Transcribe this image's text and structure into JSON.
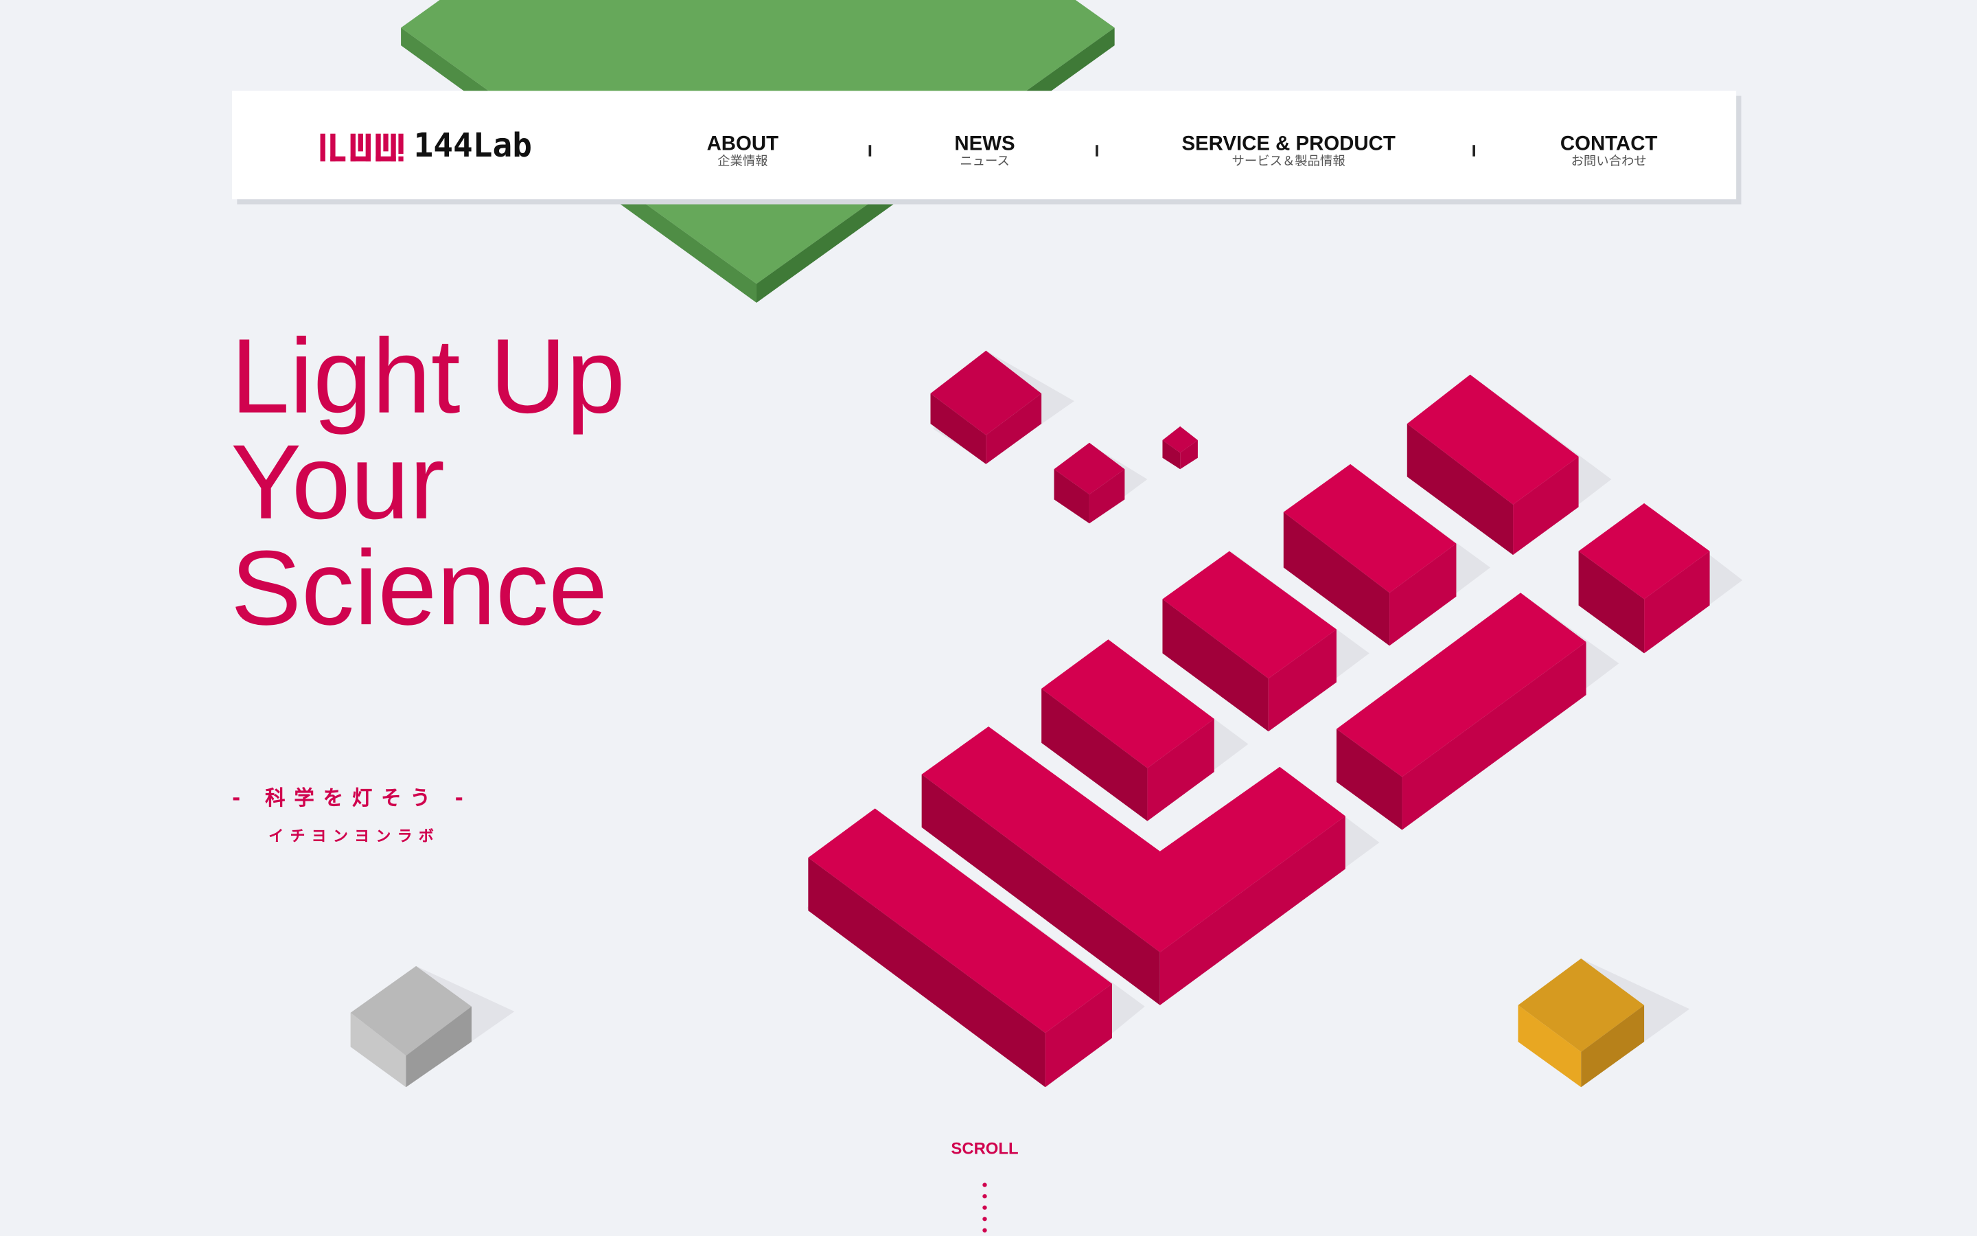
{
  "colors": {
    "accent": "#d0034e",
    "background": "#f0f2f6",
    "green": "#62a555",
    "gold": "#e3a622",
    "gray": "#b3b3b3"
  },
  "header": {
    "logo_text": "144Lab",
    "nav": [
      {
        "en": "ABOUT",
        "jp": "企業情報"
      },
      {
        "en": "NEWS",
        "jp": "ニュース"
      },
      {
        "en": "SERVICE & PRODUCT",
        "jp": "サービス＆製品情報"
      },
      {
        "en": "CONTACT",
        "jp": "お問い合わせ"
      }
    ]
  },
  "hero": {
    "lines": [
      "Light Up",
      "Your",
      "Science"
    ],
    "tagline": "- 科学を灯そう -",
    "kana": "イチヨンヨンラボ"
  },
  "scroll": {
    "label": "SCROLL"
  },
  "icons": {
    "logo_mark": "144lab-logo-mark",
    "hero_art": "isometric-blocks-illustration"
  }
}
